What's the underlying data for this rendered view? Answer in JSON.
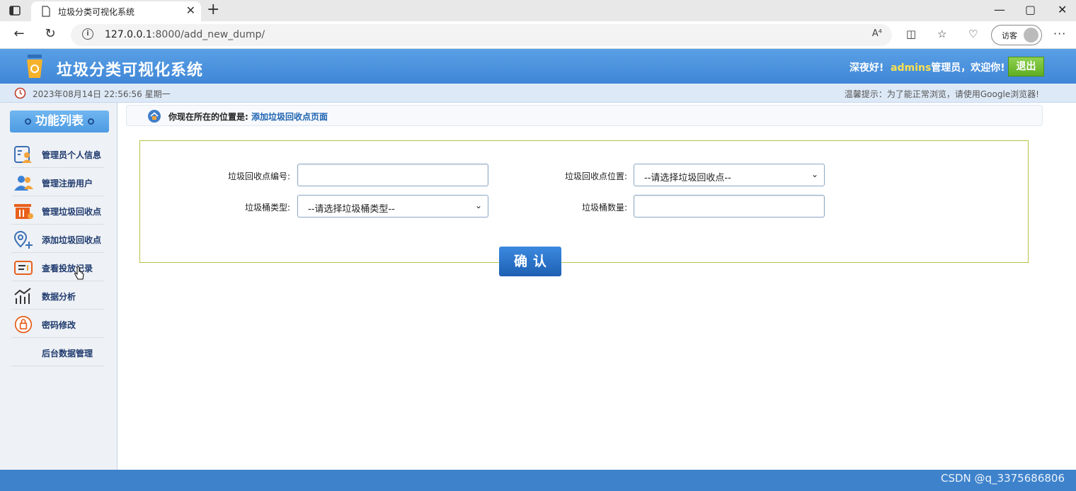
{
  "browser": {
    "tab_title": "垃圾分类可视化系统",
    "tab_close": "✕",
    "new_tab": "+",
    "url_host": "127.0.0.1",
    "url_path": ":8000/add_new_dump/",
    "read_aloud": "A⁴",
    "guest_label": "访客",
    "more": "···",
    "win_min": "—",
    "win_restore": "▢",
    "win_close": "✕"
  },
  "header": {
    "app_title": "垃圾分类可视化系统",
    "greeting_prefix": "深夜好!",
    "username": "admins",
    "greeting_suffix": "管理员，欢迎你!",
    "logout": "退出"
  },
  "infobar": {
    "datetime": "2023年08月14日 22:56:56 星期一",
    "tip": "温馨提示：为了能正常浏览，请使用Google浏览器!"
  },
  "sidebar": {
    "title": "功能列表",
    "items": [
      {
        "label": "管理员个人信息",
        "icon": "admin-profile-icon"
      },
      {
        "label": "管理注册用户",
        "icon": "users-icon"
      },
      {
        "label": "管理垃圾回收点",
        "icon": "trash-manage-icon"
      },
      {
        "label": "添加垃圾回收点",
        "icon": "add-location-icon"
      },
      {
        "label": "查看投放记录",
        "icon": "records-icon"
      },
      {
        "label": "数据分析",
        "icon": "chart-icon"
      },
      {
        "label": "密码修改",
        "icon": "lock-icon"
      },
      {
        "label": "后台数据管理",
        "icon": ""
      }
    ]
  },
  "breadcrumb": {
    "prefix": "你现在所在的位置是:",
    "location": "添加垃圾回收点页面"
  },
  "form": {
    "point_id_label": "垃圾回收点编号:",
    "point_id_value": "",
    "point_location_label": "垃圾回收点位置:",
    "point_location_selected": "--请选择垃圾回收点--",
    "bin_type_label": "垃圾桶类型:",
    "bin_type_selected": "--请选择垃圾桶类型--",
    "bin_count_label": "垃圾桶数量:",
    "bin_count_value": "",
    "confirm": "确认"
  },
  "footer": {
    "watermark": "CSDN @q_3375686806"
  },
  "colors": {
    "header_blue": "#4a90dc",
    "logout_green": "#6fbf2f",
    "username_yellow": "#ffe14d",
    "form_border": "#b5c24a"
  }
}
